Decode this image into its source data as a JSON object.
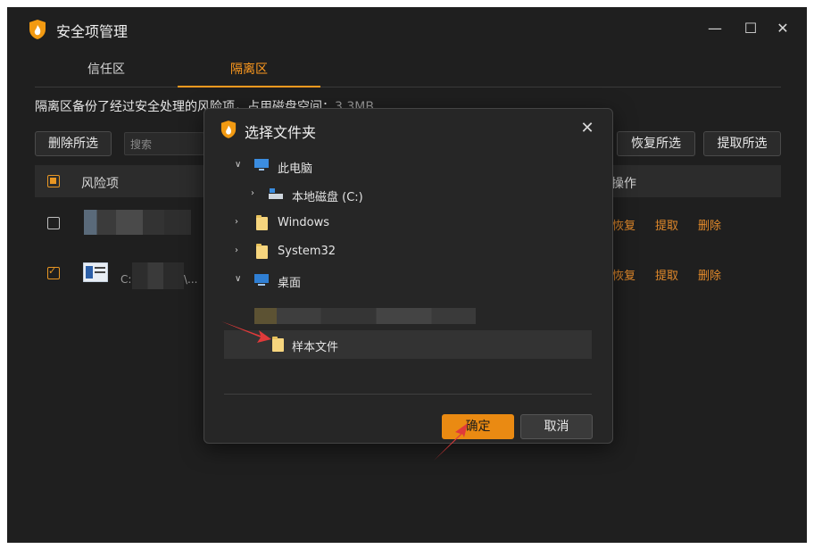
{
  "window": {
    "title": "安全项管理",
    "minimize": "—",
    "maximize": "☐",
    "close": "✕"
  },
  "tabs": [
    {
      "label": "信任区"
    },
    {
      "label": "隔离区"
    }
  ],
  "description": {
    "text": "隔离区备份了经过安全处理的风险项，占用磁盘空间：",
    "size": "3.3MB"
  },
  "toolbar": {
    "delete_selected": "删除所选",
    "search_placeholder": "搜索",
    "restore_selected": "恢复所选",
    "extract_selected": "提取所选"
  },
  "table": {
    "col_risk": "风险项",
    "col_action": "操作",
    "rows": [
      {
        "path_fragment": "",
        "checked": false,
        "actions": [
          "恢复",
          "提取",
          "删除"
        ]
      },
      {
        "path_fragment": "C:",
        "path_tail": "\\...",
        "checked": true,
        "actions": [
          "恢复",
          "提取",
          "删除"
        ]
      }
    ]
  },
  "dialog": {
    "title": "选择文件夹",
    "tree": [
      {
        "label": "此电脑",
        "icon": "pc-icon",
        "expanded": true
      },
      {
        "label": "本地磁盘 (C:)",
        "icon": "drive-icon",
        "expanded": false
      },
      {
        "label": "Windows",
        "icon": "folder-icon",
        "expanded": false
      },
      {
        "label": "System32",
        "icon": "folder-icon",
        "expanded": false
      },
      {
        "label": "桌面",
        "icon": "desktop-icon",
        "expanded": true
      },
      {
        "label": "样本文件",
        "icon": "folder-icon",
        "selected": true
      }
    ],
    "ok_label": "确定",
    "cancel_label": "取消"
  },
  "colors": {
    "accent": "#ea8a12",
    "background": "#1f1f1f",
    "arrow": "#e03a3a"
  }
}
